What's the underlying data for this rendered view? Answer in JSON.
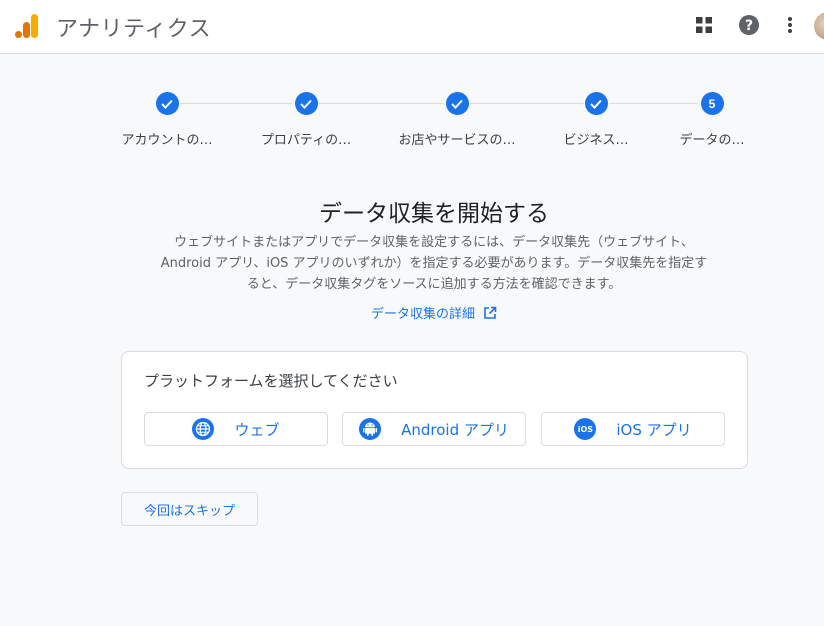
{
  "header": {
    "app_title": "アナリティクス",
    "logo_icon": "analytics-bars-icon",
    "icons": [
      "apps-grid-icon",
      "help-icon",
      "more-vert-icon"
    ],
    "accent": "#1a73e8"
  },
  "stepper": {
    "steps": [
      {
        "label": "アカウントの…",
        "state": "done"
      },
      {
        "label": "プロパティの…",
        "state": "done"
      },
      {
        "label": "お店やサービスの…",
        "state": "done"
      },
      {
        "label": "ビジネス…",
        "state": "done"
      },
      {
        "label": "データの…",
        "state": "current",
        "number": "5"
      }
    ]
  },
  "main": {
    "heading": "データ収集を開始する",
    "description": "ウェブサイトまたはアプリでデータ収集を設定するには、データ収集先（ウェブサイト、Android アプリ、iOS アプリのいずれか）を指定する必要があります。データ収集先を指定すると、データ収集タグをソースに追加する方法を確認できます。",
    "learn_more": "データ収集の詳細"
  },
  "platform_card": {
    "title": "プラットフォームを選択してください",
    "buttons": [
      {
        "label": "ウェブ",
        "icon": "globe-icon"
      },
      {
        "label": "Android アプリ",
        "icon": "android-icon"
      },
      {
        "label": "iOS アプリ",
        "icon": "ios-icon",
        "icon_text": "iOS"
      }
    ]
  },
  "skip_label": "今回はスキップ"
}
